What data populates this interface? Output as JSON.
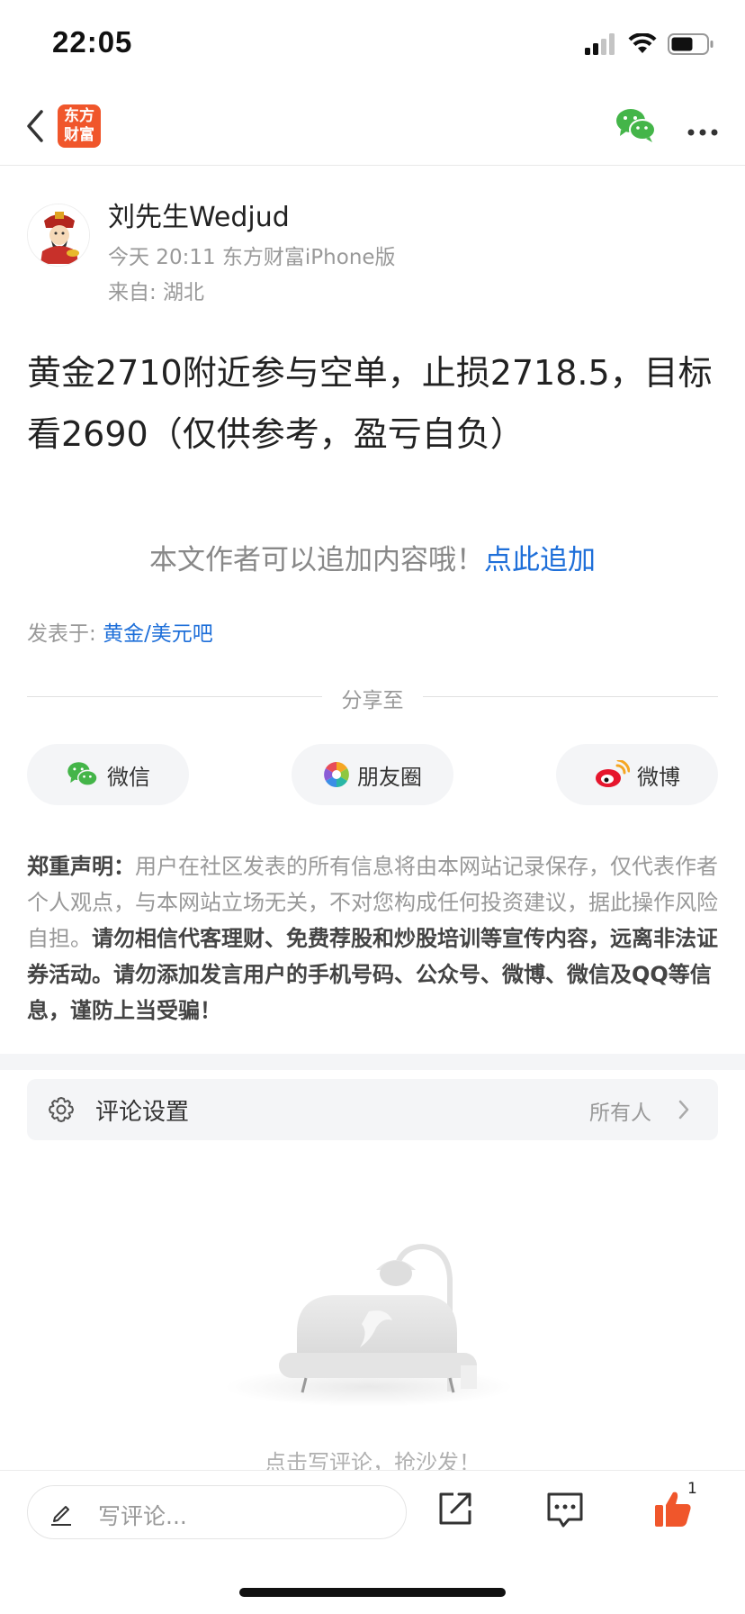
{
  "status_bar": {
    "time": "22:05"
  },
  "nav": {
    "logo_line1": "东方",
    "logo_line2": "财富"
  },
  "author": {
    "name": "刘先生Wedjud",
    "meta": "今天 20:11 东方财富iPhone版",
    "location": "来自: 湖北"
  },
  "post": {
    "content": "黄金2710附近参与空单，止损2718.5，目标看2690（仅供参考，盈亏自负）"
  },
  "append": {
    "text": "本文作者可以追加内容哦！",
    "link": "点此追加"
  },
  "posted_in": {
    "label": "发表于: ",
    "forum": "黄金/美元吧"
  },
  "share": {
    "label": "分享至",
    "buttons": [
      {
        "label": "微信",
        "icon": "wechat-icon"
      },
      {
        "label": "朋友圈",
        "icon": "moments-icon"
      },
      {
        "label": "微博",
        "icon": "weibo-icon"
      }
    ]
  },
  "disclaimer": {
    "heading": "郑重声明：",
    "normal": "用户在社区发表的所有信息将由本网站记录保存，仅代表作者个人观点，与本网站立场无关，不对您构成任何投资建议，据此操作风险自担。",
    "bold": "请勿相信代客理财、免费荐股和炒股培训等宣传内容，远离非法证券活动。请勿添加发言用户的手机号码、公众号、微博、微信及QQ等信息，谨防上当受骗！"
  },
  "comment_settings": {
    "title": "评论设置",
    "value": "所有人"
  },
  "empty_state": {
    "text": "点击写评论，抢沙发！"
  },
  "bottom_bar": {
    "input_placeholder": "写评论...",
    "like_count": "1"
  },
  "colors": {
    "brand": "#f0562b",
    "link": "#1e6fd9",
    "wechat": "#44b549",
    "like": "#f0562b"
  }
}
